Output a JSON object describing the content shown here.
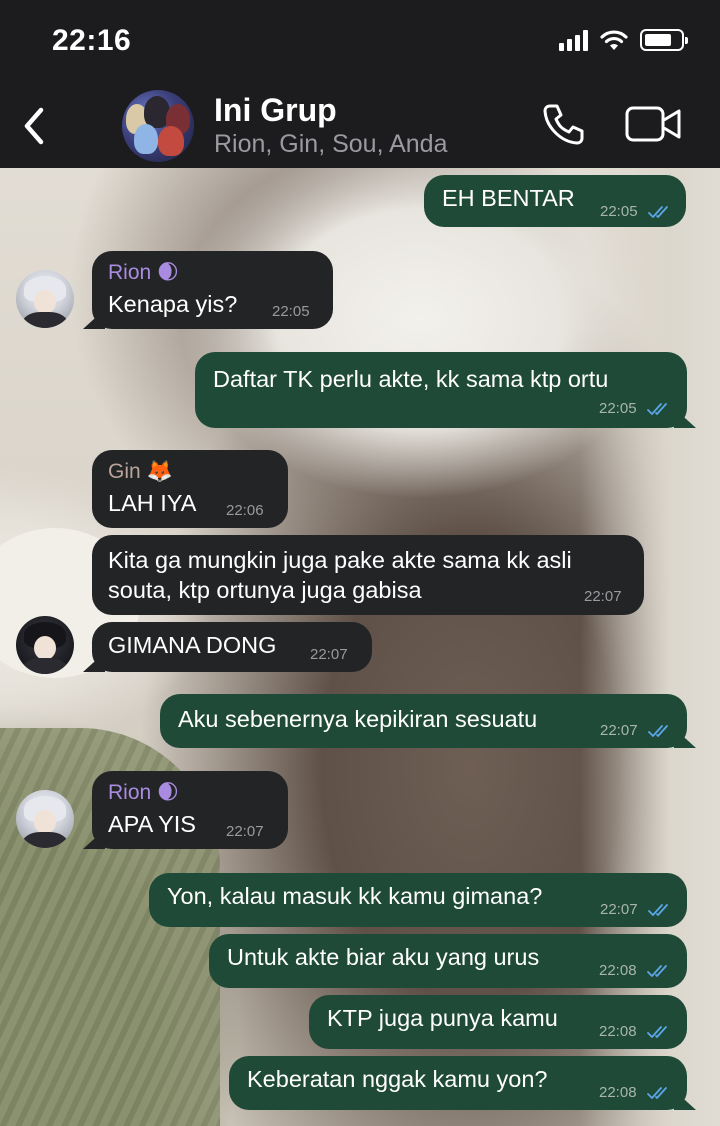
{
  "status_bar": {
    "time": "22:16",
    "battery_level": 0.75
  },
  "header": {
    "title": "Ini Grup",
    "members": "Rion, Gin, Sou, Anda"
  },
  "colors": {
    "outgoing_bubble": "#1f4a37",
    "incoming_bubble": "#232426",
    "rion_name": "#a98ce0",
    "gin_name": "#b9a39a",
    "read_ticks": "#5aa6e8"
  },
  "messages": [
    {
      "direction": "out",
      "text": "EH BENTAR",
      "time": "22:05",
      "status": "read"
    },
    {
      "direction": "in",
      "sender": "Rion 🌒",
      "text": "Kenapa yis?",
      "time": "22:05"
    },
    {
      "direction": "out",
      "text": "Daftar TK perlu akte, kk sama ktp ortu",
      "time": "22:05",
      "status": "read"
    },
    {
      "direction": "in",
      "sender": "Gin 🦊",
      "text": "LAH IYA",
      "time": "22:06"
    },
    {
      "direction": "in",
      "text_lines": [
        "Kita ga mungkin juga pake akte sama kk asli",
        "souta, ktp ortunya juga gabisa"
      ],
      "time": "22:07"
    },
    {
      "direction": "in",
      "text": "GIMANA DONG",
      "time": "22:07"
    },
    {
      "direction": "out",
      "text": "Aku sebenernya kepikiran sesuatu",
      "time": "22:07",
      "status": "read"
    },
    {
      "direction": "in",
      "sender": "Rion 🌒",
      "text": "APA YIS",
      "time": "22:07"
    },
    {
      "direction": "out",
      "text": "Yon, kalau masuk kk kamu gimana?",
      "time": "22:07",
      "status": "read"
    },
    {
      "direction": "out",
      "text": "Untuk akte biar aku yang urus",
      "time": "22:08",
      "status": "read"
    },
    {
      "direction": "out",
      "text": "KTP juga punya kamu",
      "time": "22:08",
      "status": "read"
    },
    {
      "direction": "out",
      "text": "Keberatan nggak kamu yon?",
      "time": "22:08",
      "status": "read"
    }
  ]
}
